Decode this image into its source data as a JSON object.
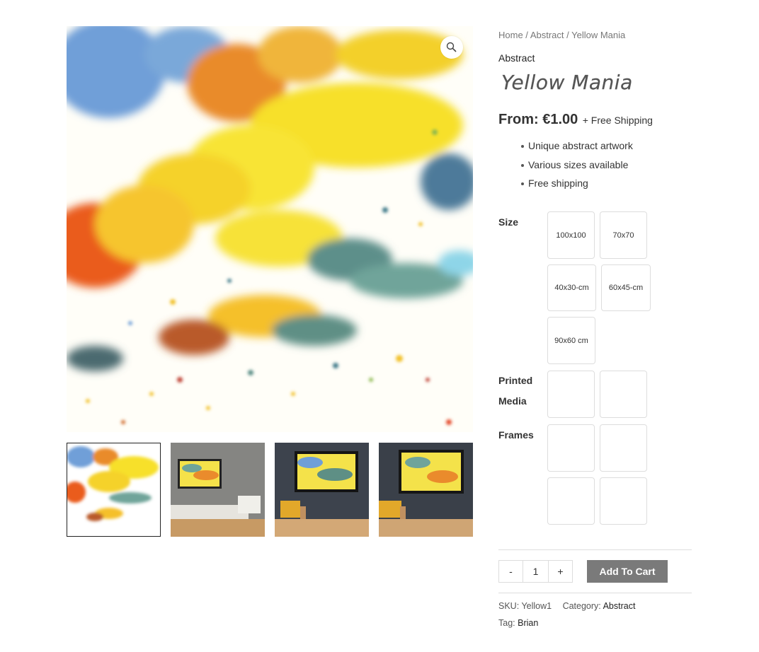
{
  "breadcrumb": {
    "home": "Home",
    "sep1": " / ",
    "category": "Abstract",
    "sep2": " / ",
    "current": "Yellow Mania"
  },
  "category_label": "Abstract",
  "title": "Yellow Mania",
  "price": {
    "from": "From: €1.00",
    "shipping": "+ Free Shipping"
  },
  "features": [
    "Unique abstract artwork",
    "Various sizes available",
    "Free shipping"
  ],
  "attributes": {
    "size_label": "Size",
    "sizes": [
      "100x100",
      "70x70",
      "40x30-cm",
      "60x45-cm",
      "90x60 cm"
    ],
    "printed_label_1": "Printed",
    "printed_label_2": "Media",
    "frames_label": "Frames"
  },
  "quantity": {
    "minus": "-",
    "value": "1",
    "plus": "+"
  },
  "add_to_cart": "Add To Cart",
  "meta": {
    "sku_label": "SKU:",
    "sku": "Yellow1",
    "category_label": "Category:",
    "category": "Abstract",
    "tag_label": "Tag:",
    "tag": "Brian"
  },
  "icons": {
    "zoom": "magnifier-icon"
  },
  "colors": {
    "button": "#7a7a7a",
    "border": "#dddddd"
  }
}
